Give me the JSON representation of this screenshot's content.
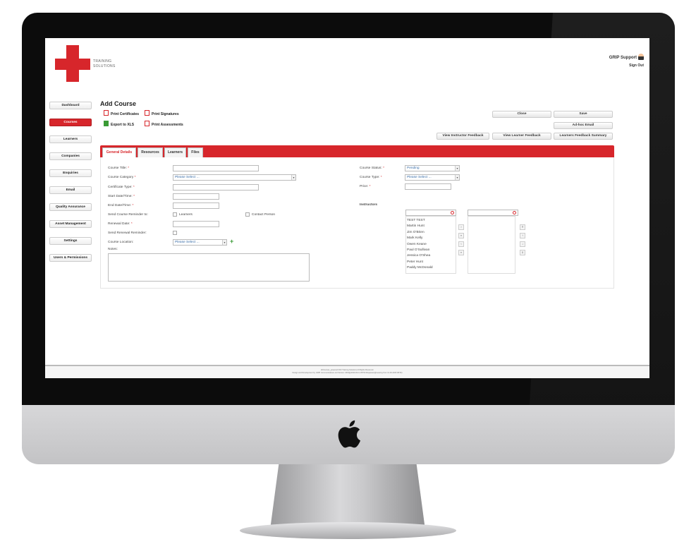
{
  "brand": {
    "name_top": "TRAINING",
    "name_bottom": "SOLUTIONS",
    "accent": "#d7262b"
  },
  "user": {
    "name": "GRIP Support",
    "sign_out": "Sign Out"
  },
  "sidebar": {
    "items": [
      {
        "label": "Dashboard"
      },
      {
        "label": "Courses",
        "active": true
      },
      {
        "label": "Learners"
      },
      {
        "label": "Companies"
      },
      {
        "label": "Enquiries"
      },
      {
        "label": "Email"
      },
      {
        "label": "Quality Assurance"
      },
      {
        "label": "Asset Management"
      },
      {
        "label": "Settings"
      },
      {
        "label": "Users & Permissions"
      }
    ]
  },
  "page": {
    "title": "Add Course"
  },
  "toolbar": {
    "print_certificates": "Print Certificates",
    "print_signatures": "Print Signatures",
    "export_xls": "Export to XLS",
    "print_assessments": "Print Assessments"
  },
  "actions": {
    "close": "Close",
    "save": "Save",
    "adhoc_email": "Ad-hoc Email",
    "view_instructor_feedback": "View Instructor Feedback",
    "view_learner_feedback": "View Learner Feedback",
    "learners_feedback_summary": "Learners Feedback Summary"
  },
  "tabs": [
    {
      "label": "General Details",
      "active": true
    },
    {
      "label": "Resources"
    },
    {
      "label": "Learners"
    },
    {
      "label": "Files"
    }
  ],
  "form": {
    "course_title": "Course Title:",
    "course_category": "Course Category",
    "course_category_value": "Please Select ...",
    "certificate_type": "Certificate Type:",
    "start_datetime": "Start Date/Time:",
    "end_datetime": "End Date/Time:",
    "send_reminder": "Send Course Reminder to:",
    "reminder_learners": "Learners",
    "reminder_contact": "Contact Person",
    "renewal_date": "Renewal Date:",
    "send_renewal": "Send Renewal Reminder:",
    "course_location": "Course Location:",
    "course_location_value": "Please Select ...",
    "notes": "Notes:",
    "course_status": "Course Status:",
    "course_status_value": "Pending",
    "course_type": "Course Type:",
    "course_type_value": "Please Select ...",
    "price": "Price:",
    "instructors": "Instructors",
    "required_mark": "*"
  },
  "instructor_list": [
    "TEST TEST",
    "Martin Hunt",
    "Jim O'Brien",
    "Mark Kelly",
    "Owen Keane",
    "Paul O'Sullivan",
    "Jessica O'Shea",
    "Peter Hunt",
    "Paddy McDonald"
  ],
  "footer": {
    "line1": "AllCourses_powered DX2 Training Solutions All Rights Reserved.",
    "line2": "Design and Development by GRIP Communications Ltd Version: 2019@2020-03-11 08:53:00(apiuser@Leaving from 11-03-2020 08:53)"
  }
}
